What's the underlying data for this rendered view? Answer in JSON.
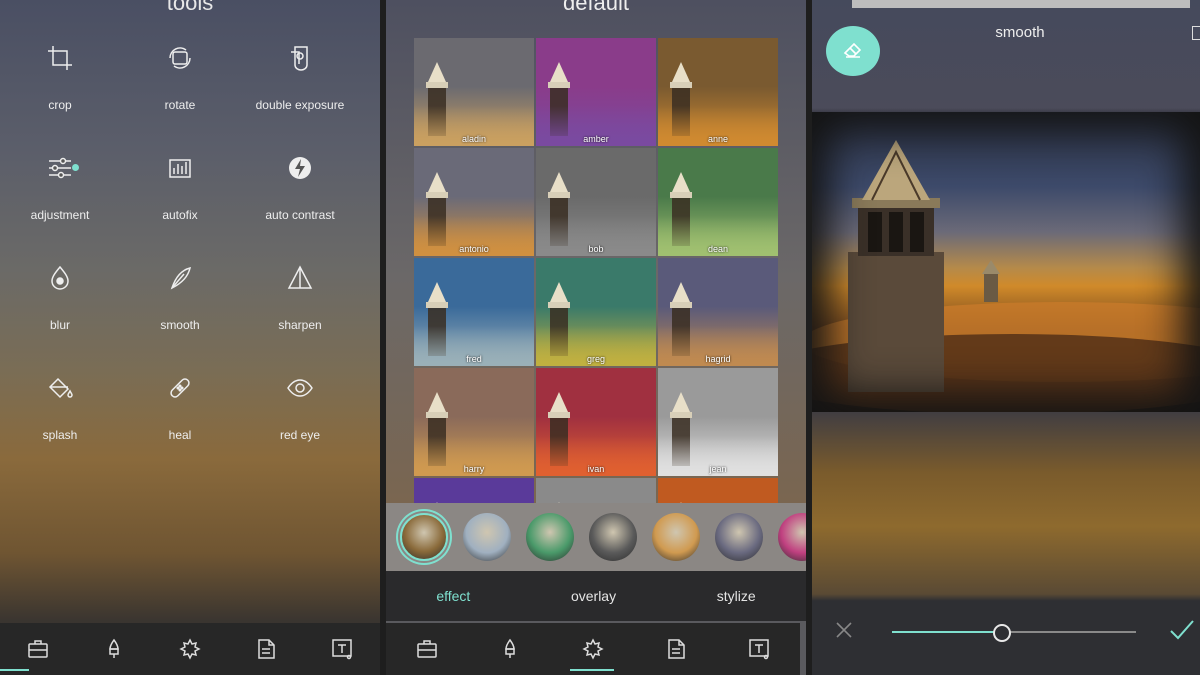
{
  "colors": {
    "accent": "#7fe0cf"
  },
  "left": {
    "title": "tools",
    "tools": [
      {
        "label": "crop",
        "icon": "crop-icon"
      },
      {
        "label": "rotate",
        "icon": "rotate-icon"
      },
      {
        "label": "double exposure",
        "icon": "double-exposure-icon"
      },
      {
        "label": "adjustment",
        "icon": "adjustment-icon"
      },
      {
        "label": "autofix",
        "icon": "autofix-icon"
      },
      {
        "label": "auto contrast",
        "icon": "auto-contrast-icon"
      },
      {
        "label": "blur",
        "icon": "blur-icon"
      },
      {
        "label": "smooth",
        "icon": "smooth-icon"
      },
      {
        "label": "sharpen",
        "icon": "sharpen-icon"
      },
      {
        "label": "splash",
        "icon": "splash-icon"
      },
      {
        "label": "heal",
        "icon": "heal-icon"
      },
      {
        "label": "red eye",
        "icon": "red-eye-icon"
      }
    ],
    "nav_active": "toolbox-icon"
  },
  "mid": {
    "title": "default",
    "effects": [
      {
        "name": "aladin",
        "sky": "#6b6a70",
        "cloud": "#caa060"
      },
      {
        "name": "amber",
        "sky": "#8a3c8a",
        "cloud": "#7a4aa0"
      },
      {
        "name": "anne",
        "sky": "#7a5a30",
        "cloud": "#d08a30"
      },
      {
        "name": "antonio",
        "sky": "#6a6a78",
        "cloud": "#d09040"
      },
      {
        "name": "bob",
        "sky": "#6a6a6a",
        "cloud": "#8a8a8a"
      },
      {
        "name": "dean",
        "sky": "#4a7a4a",
        "cloud": "#a0c070"
      },
      {
        "name": "fred",
        "sky": "#3a6a9a",
        "cloud": "#9ab0b8"
      },
      {
        "name": "greg",
        "sky": "#3a7a6a",
        "cloud": "#c0b040"
      },
      {
        "name": "hagrid",
        "sky": "#5a5a7a",
        "cloud": "#c08a50"
      },
      {
        "name": "harry",
        "sky": "#8a6a5a",
        "cloud": "#d09a50"
      },
      {
        "name": "ivan",
        "sky": "#a03040",
        "cloud": "#e06030"
      },
      {
        "name": "jean",
        "sky": "#9a9a9a",
        "cloud": "#e0e0e0"
      },
      {
        "name": "",
        "sky": "#5a3a9a",
        "cloud": "#6a4aa0"
      },
      {
        "name": "",
        "sky": "#8a8a8a",
        "cloud": "#a0a0a0"
      },
      {
        "name": "",
        "sky": "#c05a20",
        "cloud": "#d07030"
      }
    ],
    "thumbs": [
      "#8a6a3a",
      "#a0b0c0",
      "#4a9a6a",
      "#5a5a5a",
      "#d09a50",
      "#6a6a80",
      "#c04080"
    ],
    "tabs": [
      "effect",
      "overlay",
      "stylize"
    ],
    "active_tab": "effect"
  },
  "right": {
    "title": "smooth",
    "slider_value": 0.45
  }
}
